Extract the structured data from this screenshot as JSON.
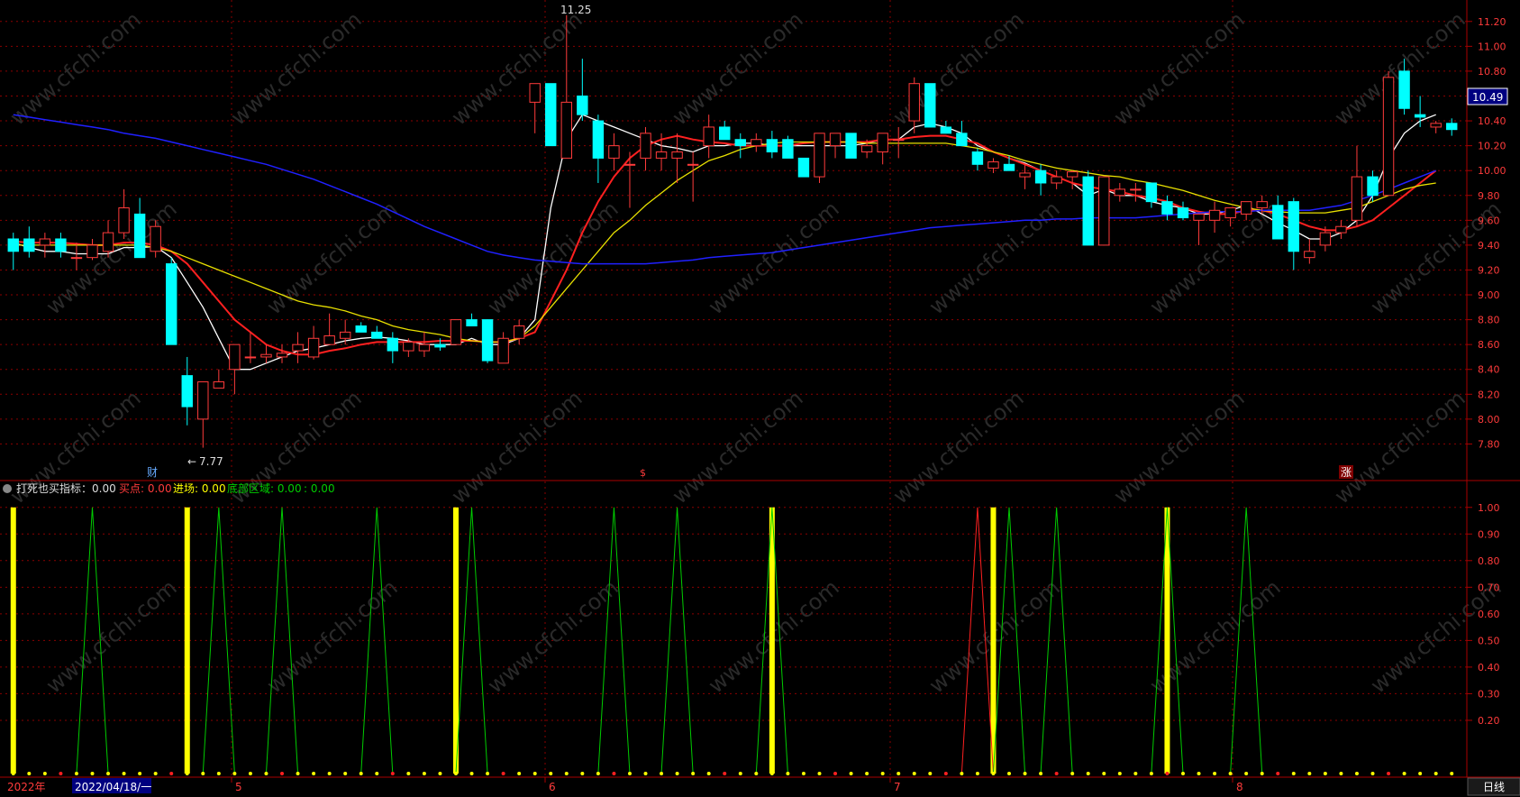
{
  "price_axis_ticks": [
    "11.20",
    "11.00",
    "10.80",
    "10.60",
    "10.40",
    "10.20",
    "10.00",
    "9.80",
    "9.60",
    "9.40",
    "9.20",
    "9.00",
    "8.80",
    "8.60",
    "8.40",
    "8.20",
    "8.00",
    "7.80"
  ],
  "indicator_axis_ticks": [
    "1.00",
    "0.90",
    "0.80",
    "0.70",
    "0.60",
    "0.50",
    "0.40",
    "0.30",
    "0.20"
  ],
  "current_price": "10.49",
  "high_marker": "11.25",
  "low_marker": "7.77",
  "event_markers": [
    "财",
    "$",
    "涨"
  ],
  "indicator_header": {
    "name": "打死也买指标：0.00",
    "buy_label": "买点: 0.00",
    "entry_label": "进场: 0.00",
    "bottom_label": "底部区域: 0.00",
    "last_label": ": 0.00"
  },
  "time_axis": {
    "year_label": "2022年",
    "cursor_date": "2022/04/18/一",
    "month_labels": [
      "5",
      "6",
      "7",
      "8"
    ],
    "period_button": "日线"
  },
  "watermark": "www.cfchi.com",
  "colors": {
    "up": "#ff3b3b",
    "down": "#00ffff",
    "ma5": "#ffffff",
    "ma10": "#ff2020",
    "ma20": "#e8e000",
    "ma60": "#2020ff",
    "grid": "#8b0000",
    "bottom_area": "#00cc00",
    "entry": "#ffff00",
    "buy": "#ff2020"
  },
  "chart_data": [
    {
      "type": "candlestick",
      "y_range": [
        7.6,
        11.3
      ],
      "candles": [
        [
          9.45,
          9.5,
          9.2,
          9.35
        ],
        [
          9.45,
          9.55,
          9.3,
          9.35
        ],
        [
          9.4,
          9.5,
          9.3,
          9.45
        ],
        [
          9.45,
          9.5,
          9.3,
          9.35
        ],
        [
          9.3,
          9.42,
          9.2,
          9.3
        ],
        [
          9.3,
          9.45,
          9.28,
          9.4
        ],
        [
          9.35,
          9.6,
          9.3,
          9.5
        ],
        [
          9.5,
          9.85,
          9.45,
          9.7
        ],
        [
          9.65,
          9.78,
          9.3,
          9.3
        ],
        [
          9.35,
          9.6,
          9.3,
          9.55
        ],
        [
          9.25,
          9.3,
          8.6,
          8.6
        ],
        [
          8.35,
          8.5,
          7.95,
          8.1
        ],
        [
          8.0,
          8.3,
          7.77,
          8.3
        ],
        [
          8.25,
          8.4,
          8.25,
          8.3
        ],
        [
          8.4,
          8.6,
          8.2,
          8.6
        ],
        [
          8.5,
          8.7,
          8.45,
          8.5
        ],
        [
          8.5,
          8.6,
          8.45,
          8.52
        ],
        [
          8.5,
          8.6,
          8.45,
          8.53
        ],
        [
          8.55,
          8.7,
          8.45,
          8.6
        ],
        [
          8.5,
          8.75,
          8.48,
          8.65
        ],
        [
          8.6,
          8.85,
          8.6,
          8.67
        ],
        [
          8.65,
          8.8,
          8.6,
          8.7
        ],
        [
          8.75,
          8.78,
          8.7,
          8.7
        ],
        [
          8.7,
          8.75,
          8.65,
          8.65
        ],
        [
          8.65,
          8.7,
          8.45,
          8.55
        ],
        [
          8.55,
          8.65,
          8.5,
          8.62
        ],
        [
          8.55,
          8.7,
          8.5,
          8.6
        ],
        [
          8.6,
          8.65,
          8.55,
          8.58
        ],
        [
          8.6,
          8.8,
          8.6,
          8.8
        ],
        [
          8.8,
          8.85,
          8.75,
          8.75
        ],
        [
          8.8,
          8.8,
          8.45,
          8.47
        ],
        [
          8.45,
          8.7,
          8.45,
          8.65
        ],
        [
          8.65,
          8.8,
          8.6,
          8.75
        ],
        [
          10.55,
          10.7,
          10.3,
          10.7
        ],
        [
          10.7,
          10.7,
          10.2,
          10.2
        ],
        [
          10.1,
          11.25,
          10.1,
          10.55
        ],
        [
          10.6,
          10.9,
          10.4,
          10.45
        ],
        [
          10.4,
          10.45,
          9.9,
          10.1
        ],
        [
          10.1,
          10.3,
          10.0,
          10.2
        ],
        [
          10.05,
          10.15,
          9.7,
          10.05
        ],
        [
          10.1,
          10.35,
          10.0,
          10.3
        ],
        [
          10.1,
          10.3,
          10.0,
          10.15
        ],
        [
          10.1,
          10.3,
          9.9,
          10.15
        ],
        [
          10.05,
          10.15,
          9.75,
          10.05
        ],
        [
          10.2,
          10.45,
          10.1,
          10.35
        ],
        [
          10.35,
          10.4,
          10.25,
          10.25
        ],
        [
          10.25,
          10.3,
          10.1,
          10.2
        ],
        [
          10.2,
          10.3,
          10.15,
          10.25
        ],
        [
          10.25,
          10.32,
          10.1,
          10.15
        ],
        [
          10.25,
          10.28,
          10.1,
          10.1
        ],
        [
          10.1,
          10.1,
          9.95,
          9.95
        ],
        [
          9.95,
          10.3,
          9.9,
          10.3
        ],
        [
          10.2,
          10.3,
          10.1,
          10.3
        ],
        [
          10.3,
          10.3,
          10.1,
          10.1
        ],
        [
          10.15,
          10.25,
          10.1,
          10.2
        ],
        [
          10.15,
          10.3,
          10.05,
          10.3
        ],
        [
          10.25,
          10.35,
          10.1,
          10.25
        ],
        [
          10.4,
          10.75,
          10.3,
          10.7
        ],
        [
          10.7,
          10.7,
          10.35,
          10.35
        ],
        [
          10.35,
          10.4,
          10.3,
          10.3
        ],
        [
          10.3,
          10.4,
          10.2,
          10.2
        ],
        [
          10.15,
          10.18,
          10.0,
          10.05
        ],
        [
          10.02,
          10.1,
          9.98,
          10.07
        ],
        [
          10.05,
          10.12,
          10.0,
          10.0
        ],
        [
          9.95,
          10.05,
          9.85,
          9.98
        ],
        [
          10.0,
          10.05,
          9.8,
          9.9
        ],
        [
          9.9,
          10.0,
          9.85,
          9.95
        ],
        [
          9.95,
          10.0,
          9.85,
          9.99
        ],
        [
          9.95,
          10.0,
          9.4,
          9.4
        ],
        [
          9.4,
          9.95,
          9.4,
          9.95
        ],
        [
          9.8,
          9.9,
          9.75,
          9.85
        ],
        [
          9.85,
          9.9,
          9.75,
          9.85
        ],
        [
          9.9,
          9.9,
          9.7,
          9.75
        ],
        [
          9.75,
          9.8,
          9.6,
          9.65
        ],
        [
          9.7,
          9.75,
          9.6,
          9.62
        ],
        [
          9.6,
          9.65,
          9.4,
          9.65
        ],
        [
          9.6,
          9.75,
          9.5,
          9.68
        ],
        [
          9.62,
          9.7,
          9.55,
          9.7
        ],
        [
          9.65,
          9.75,
          9.6,
          9.75
        ],
        [
          9.7,
          9.8,
          9.65,
          9.75
        ],
        [
          9.72,
          9.8,
          9.55,
          9.45
        ],
        [
          9.75,
          9.78,
          9.2,
          9.35
        ],
        [
          9.3,
          9.45,
          9.25,
          9.35
        ],
        [
          9.4,
          9.55,
          9.35,
          9.5
        ],
        [
          9.5,
          9.6,
          9.45,
          9.55
        ],
        [
          9.6,
          10.2,
          9.55,
          9.95
        ],
        [
          9.95,
          10.0,
          9.75,
          9.8
        ],
        [
          9.8,
          10.8,
          9.8,
          10.75
        ],
        [
          10.8,
          10.9,
          10.45,
          10.5
        ],
        [
          10.45,
          10.6,
          10.35,
          10.43
        ],
        [
          10.35,
          10.4,
          10.3,
          10.38
        ],
        [
          10.38,
          10.42,
          10.28,
          10.33
        ]
      ],
      "lines": [
        {
          "name": "MA5",
          "values": [
            9.42,
            9.38,
            9.35,
            9.35,
            9.33,
            9.33,
            9.33,
            9.38,
            9.38,
            9.39,
            9.3,
            9.1,
            8.9,
            8.65,
            8.4,
            8.4,
            8.45,
            8.5,
            8.55,
            8.57,
            8.6,
            8.63,
            8.65,
            8.66,
            8.65,
            8.63,
            8.6,
            8.6,
            8.6,
            8.65,
            8.6,
            8.6,
            8.65,
            8.8,
            9.7,
            10.25,
            10.45,
            10.4,
            10.35,
            10.3,
            10.25,
            10.2,
            10.18,
            10.15,
            10.2,
            10.2,
            10.22,
            10.22,
            10.2,
            10.2,
            10.2,
            10.2,
            10.2,
            10.2,
            10.22,
            10.25,
            10.25,
            10.35,
            10.38,
            10.35,
            10.3,
            10.2,
            10.15,
            10.1,
            10.06,
            10.0,
            9.95,
            9.9,
            9.8,
            9.85,
            9.8,
            9.8,
            9.75,
            9.72,
            9.7,
            9.65,
            9.65,
            9.68,
            9.72,
            9.65,
            9.58,
            9.52,
            9.45,
            9.45,
            9.5,
            9.6,
            9.8,
            10.1,
            10.3,
            10.4,
            10.45
          ]
        },
        {
          "name": "MA10",
          "values": [
            9.43,
            9.42,
            9.42,
            9.42,
            9.41,
            9.4,
            9.4,
            9.42,
            9.42,
            9.4,
            9.35,
            9.25,
            9.1,
            8.95,
            8.8,
            8.7,
            8.6,
            8.55,
            8.52,
            8.52,
            8.55,
            8.57,
            8.6,
            8.62,
            8.62,
            8.62,
            8.62,
            8.63,
            8.63,
            8.63,
            8.62,
            8.62,
            8.65,
            8.7,
            8.95,
            9.2,
            9.5,
            9.75,
            9.95,
            10.1,
            10.2,
            10.25,
            10.28,
            10.25,
            10.23,
            10.22,
            10.2,
            10.2,
            10.2,
            10.2,
            10.22,
            10.23,
            10.23,
            10.23,
            10.23,
            10.25,
            10.25,
            10.27,
            10.28,
            10.28,
            10.25,
            10.22,
            10.15,
            10.1,
            10.05,
            10.0,
            9.95,
            9.9,
            9.87,
            9.85,
            9.83,
            9.8,
            9.78,
            9.75,
            9.7,
            9.67,
            9.65,
            9.65,
            9.68,
            9.68,
            9.65,
            9.6,
            9.55,
            9.52,
            9.52,
            9.55,
            9.6,
            9.7,
            9.8,
            9.9,
            10.0
          ]
        },
        {
          "name": "MA20",
          "values": [
            9.4,
            9.4,
            9.4,
            9.4,
            9.4,
            9.4,
            9.4,
            9.4,
            9.4,
            9.38,
            9.35,
            9.3,
            9.25,
            9.2,
            9.15,
            9.1,
            9.05,
            9.0,
            8.95,
            8.92,
            8.9,
            8.87,
            8.83,
            8.8,
            8.75,
            8.72,
            8.7,
            8.68,
            8.65,
            8.63,
            8.62,
            8.62,
            8.65,
            8.75,
            8.9,
            9.05,
            9.2,
            9.35,
            9.5,
            9.6,
            9.72,
            9.82,
            9.92,
            10.0,
            10.08,
            10.12,
            10.17,
            10.2,
            10.22,
            10.23,
            10.23,
            10.23,
            10.23,
            10.23,
            10.22,
            10.22,
            10.22,
            10.22,
            10.22,
            10.22,
            10.2,
            10.18,
            10.15,
            10.12,
            10.08,
            10.05,
            10.02,
            10.0,
            9.98,
            9.96,
            9.95,
            9.92,
            9.9,
            9.87,
            9.84,
            9.8,
            9.76,
            9.73,
            9.7,
            9.68,
            9.67,
            9.66,
            9.66,
            9.66,
            9.68,
            9.7,
            9.75,
            9.8,
            9.85,
            9.88,
            9.9
          ]
        },
        {
          "name": "MA60",
          "values": [
            10.45,
            10.43,
            10.41,
            10.39,
            10.37,
            10.35,
            10.33,
            10.3,
            10.28,
            10.26,
            10.23,
            10.2,
            10.17,
            10.14,
            10.11,
            10.08,
            10.05,
            10.01,
            9.97,
            9.93,
            9.88,
            9.83,
            9.78,
            9.73,
            9.67,
            9.61,
            9.55,
            9.5,
            9.45,
            9.4,
            9.35,
            9.32,
            9.3,
            9.28,
            9.27,
            9.26,
            9.25,
            9.25,
            9.25,
            9.25,
            9.25,
            9.26,
            9.27,
            9.28,
            9.3,
            9.31,
            9.32,
            9.33,
            9.34,
            9.36,
            9.38,
            9.4,
            9.42,
            9.44,
            9.46,
            9.48,
            9.5,
            9.52,
            9.54,
            9.55,
            9.56,
            9.57,
            9.58,
            9.59,
            9.6,
            9.6,
            9.61,
            9.61,
            9.62,
            9.62,
            9.62,
            9.62,
            9.63,
            9.64,
            9.65,
            9.66,
            9.67,
            9.67,
            9.67,
            9.68,
            9.68,
            9.68,
            9.68,
            9.7,
            9.72,
            9.76,
            9.8,
            9.85,
            9.9,
            9.95,
            10.0
          ]
        }
      ]
    },
    {
      "type": "spikes",
      "y_range": [
        0,
        1.05
      ],
      "series": [
        {
          "name": "进场",
          "color": "#ffff00",
          "indices": [
            0,
            11,
            28,
            48,
            62,
            73
          ]
        },
        {
          "name": "买点",
          "color": "#ff2020",
          "indices": [
            61
          ]
        },
        {
          "name": "底部区域",
          "color": "#00cc00",
          "indices": [
            5,
            13,
            17,
            23,
            29,
            38,
            42,
            48,
            63,
            66,
            73,
            78
          ]
        }
      ]
    }
  ]
}
